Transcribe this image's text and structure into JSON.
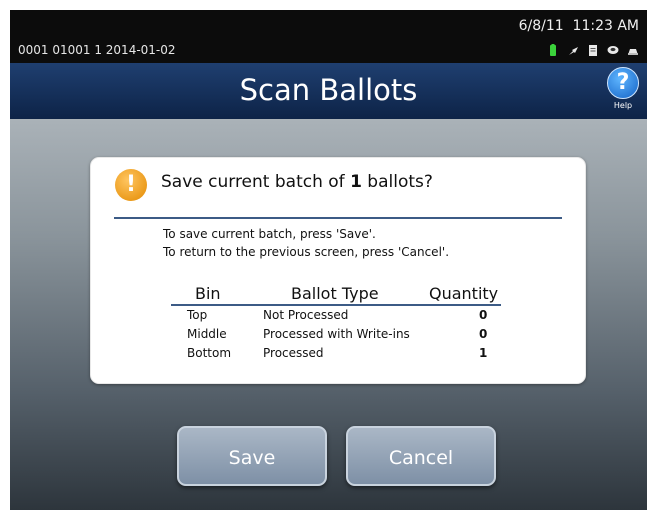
{
  "status_bar": {
    "device_info": "0001 01001 1   2014-01-02",
    "date": "6/8/11",
    "time": "11:23 AM",
    "icons": [
      "battery-icon",
      "plug-icon",
      "document-icon",
      "cloud-icon",
      "drive-icon"
    ]
  },
  "header": {
    "title": "Scan Ballots",
    "help_label": "Help",
    "help_glyph": "?"
  },
  "dialog": {
    "title_prefix": "Save current batch of ",
    "title_count": "1",
    "title_suffix": " ballots?",
    "instructions": [
      "To save current batch, press 'Save'.",
      "To return to the previous screen, press 'Cancel'."
    ],
    "table": {
      "headers": [
        "Bin",
        "Ballot Type",
        "Quantity"
      ],
      "rows": [
        {
          "bin": "Top",
          "type": "Not Processed",
          "qty": "0"
        },
        {
          "bin": "Middle",
          "type": "Processed with Write-ins",
          "qty": "0"
        },
        {
          "bin": "Bottom",
          "type": "Processed",
          "qty": "1"
        }
      ]
    }
  },
  "buttons": {
    "save": "Save",
    "cancel": "Cancel"
  },
  "colors": {
    "header_bg": "#1f3f70",
    "warning": "#f5a623",
    "rule": "#3c5b86",
    "button": "#8d9db0"
  }
}
